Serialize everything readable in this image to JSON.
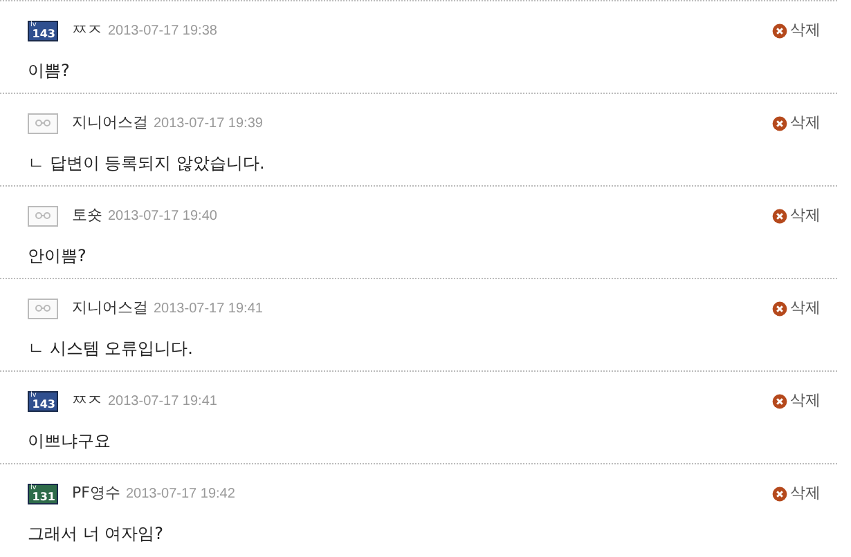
{
  "comments": [
    {
      "badge": {
        "kind": "level",
        "prefix": "lv",
        "number": "143",
        "color": "#2f4f8f"
      },
      "author": "ㅉㅈ",
      "date": "2013-07-17 19:38",
      "text": "이쁨?",
      "delete": "삭제"
    },
    {
      "badge": {
        "kind": "guest"
      },
      "author": "지니어스걸",
      "date": "2013-07-17 19:39",
      "text": "ㄴ 답변이 등록되지 않았습니다.",
      "delete": "삭제"
    },
    {
      "badge": {
        "kind": "guest"
      },
      "author": "토숏",
      "date": "2013-07-17 19:40",
      "text": "안이쁨?",
      "delete": "삭제"
    },
    {
      "badge": {
        "kind": "guest"
      },
      "author": "지니어스걸",
      "date": "2013-07-17 19:41",
      "text": "ㄴ 시스템 오류입니다.",
      "delete": "삭제"
    },
    {
      "badge": {
        "kind": "level",
        "prefix": "lv",
        "number": "143",
        "color": "#2f4f8f"
      },
      "author": "ㅉㅈ",
      "date": "2013-07-17 19:41",
      "text": "이쁘냐구요",
      "delete": "삭제"
    },
    {
      "badge": {
        "kind": "level",
        "prefix": "lv",
        "number": "131",
        "color": "#2e6b4a"
      },
      "author": "PF영수",
      "date": "2013-07-17 19:42",
      "text": "그래서 너 여자임?",
      "delete": "삭제"
    }
  ]
}
